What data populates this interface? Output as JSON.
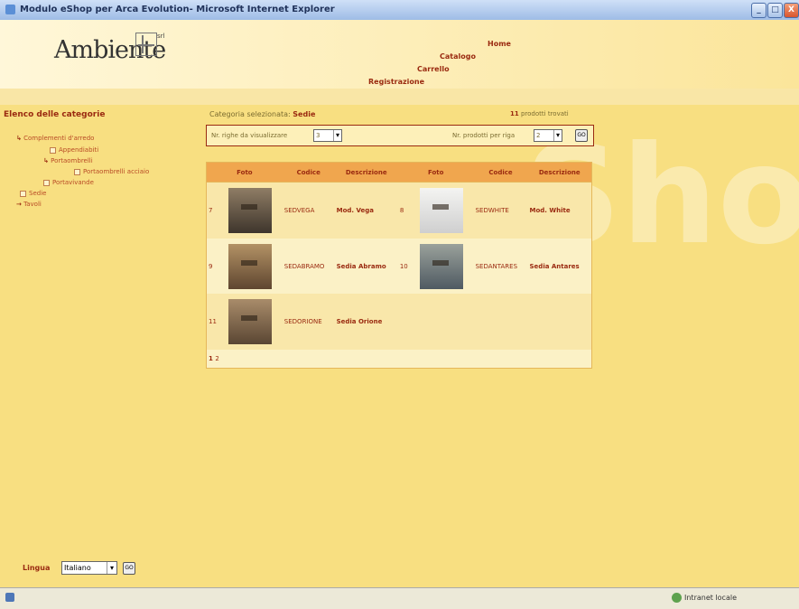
{
  "window": {
    "title": "Modulo eShop per Arca Evolution- Microsoft Internet Explorer",
    "minimize": "_",
    "maximize": "□",
    "close": "X"
  },
  "header": {
    "logo": "Ambiente",
    "logo_suffix": "srl",
    "nav": [
      "Home",
      "Catalogo",
      "Carrello",
      "Registrazione"
    ]
  },
  "sidebar": {
    "title": "Elenco delle categorie",
    "items": [
      "Complementi d'arredo",
      "Appendiabiti",
      "Portaombrelli",
      "Portaombrelli acciaio",
      "Portavivande",
      "Sedie",
      "Tavoli"
    ]
  },
  "main": {
    "category_label": "Categoria selezionata:",
    "category_value": "Sedie",
    "found_count": "11",
    "found_label": "prodotti trovati",
    "rows_label": "Nr. righe da visualizzare",
    "rows_value": "3",
    "perrow_label": "Nr. prodotti per riga",
    "perrow_value": "2",
    "go_label": "GO",
    "table": {
      "headers": [
        "Foto",
        "Codice",
        "Descrizione",
        "Foto",
        "Codice",
        "Descrizione"
      ],
      "rows": [
        [
          {
            "num": "7",
            "code": "SEDVEGA",
            "desc": "Mod. Vega"
          },
          {
            "num": "8",
            "code": "SEDWHITE",
            "desc": "Mod. White"
          }
        ],
        [
          {
            "num": "9",
            "code": "SEDABRAMO",
            "desc": "Sedia Abramo"
          },
          {
            "num": "10",
            "code": "SEDANTARES",
            "desc": "Sedia Antares"
          }
        ],
        [
          {
            "num": "11",
            "code": "SEDORIONE",
            "desc": "Sedia Orione"
          }
        ]
      ]
    },
    "pages": [
      "1",
      "2"
    ],
    "watermark": "Sho"
  },
  "footer": {
    "lang_label": "Lingua",
    "lang_value": "Italiano",
    "go_label": "GO"
  },
  "statusbar": {
    "zone": "Intranet locale"
  },
  "colors": {
    "accent": "#9a2a10",
    "background": "#f8df81",
    "table_header": "#f0a64e"
  }
}
